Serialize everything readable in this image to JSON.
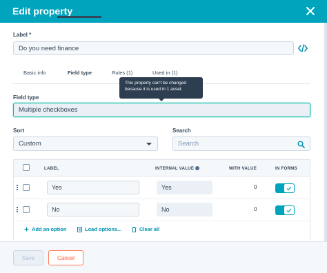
{
  "header": {
    "title": "Edit property"
  },
  "label_section": {
    "label": "Label *",
    "value": "Do you need finance"
  },
  "tabs": [
    {
      "label": "Basic info",
      "active": false
    },
    {
      "label": "Field type",
      "active": true
    },
    {
      "label": "Rules (1)",
      "active": false
    },
    {
      "label": "Used in (1)",
      "active": false
    }
  ],
  "tooltip": {
    "line1": "This property can't be changed",
    "line2": "because it is used in 1 asset."
  },
  "field_type": {
    "label": "Field type",
    "value": "Multiple checkboxes"
  },
  "sort": {
    "label": "Sort",
    "value": "Custom"
  },
  "search": {
    "label": "Search",
    "placeholder": "Search"
  },
  "table": {
    "headers": {
      "label": "LABEL",
      "internal_value": "INTERNAL VALUE",
      "with_value": "WITH VALUE",
      "in_forms": "IN FORMS"
    },
    "rows": [
      {
        "label": "Yes",
        "internal_value": "Yes",
        "with_value": "0",
        "in_forms": true
      },
      {
        "label": "No",
        "internal_value": "No",
        "with_value": "0",
        "in_forms": true
      }
    ]
  },
  "actions": {
    "add_option": "Add an option",
    "load_options": "Load options...",
    "clear_all": "Clear all"
  },
  "footer": {
    "save": "Save",
    "cancel": "Cancel"
  },
  "colors": {
    "header": "#00a4bd",
    "accent": "#0091ae",
    "cancel": "#ff5c35"
  },
  "icons": {
    "close": "close-icon",
    "code": "code-icon",
    "search": "search-icon",
    "plus": "plus-icon",
    "load": "list-icon",
    "clear": "trash-icon",
    "drag": "drag-handle-icon"
  }
}
